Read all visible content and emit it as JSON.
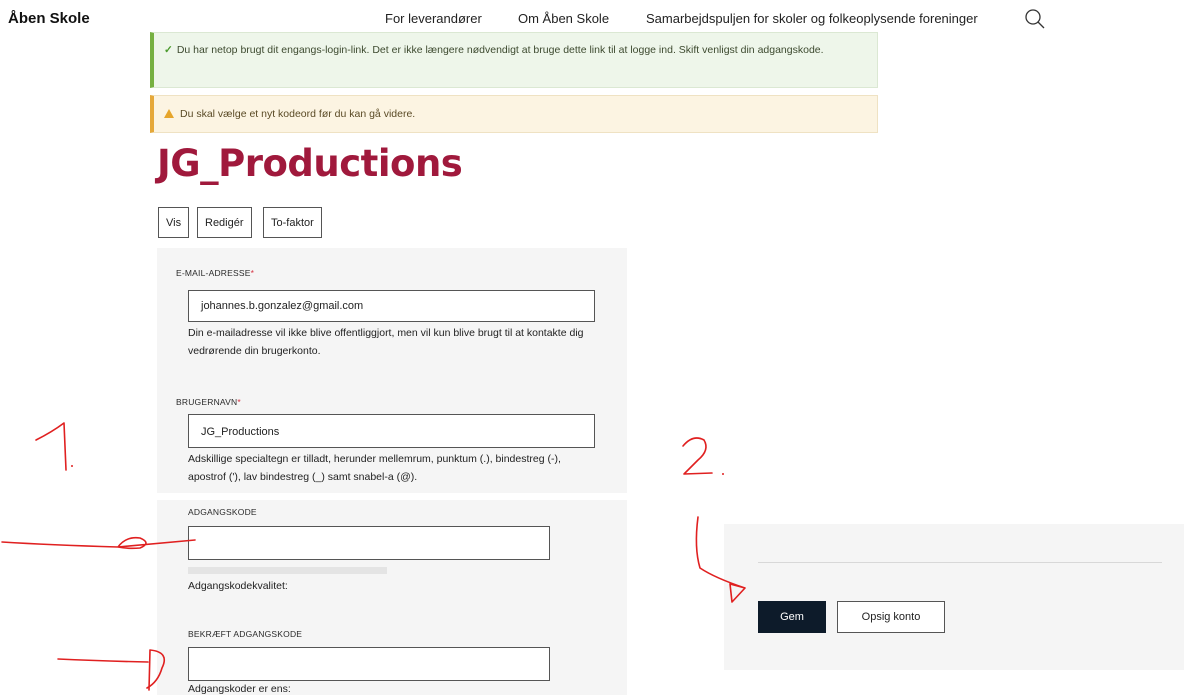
{
  "header": {
    "logo": "Åben Skole",
    "nav": [
      "For leverandører",
      "Om Åben Skole",
      "Samarbejdspuljen for skoler og folkeoplysende foreninger"
    ],
    "search_icon": "search-icon"
  },
  "messages": {
    "status": "Du har netop brugt dit engangs-login-link. Det er ikke længere nødvendigt at bruge dette link til at logge ind. Skift venligst din adgangskode.",
    "warning": "Du skal vælge et nyt kodeord før du kan gå videre."
  },
  "page": {
    "title": "JG_Productions"
  },
  "tabs": [
    "Vis",
    "Redigér",
    "To-faktor"
  ],
  "form": {
    "email": {
      "label": "E-MAIL-ADRESSE",
      "required_marker": "*",
      "value": "johannes.b.gonzalez@gmail.com",
      "help": "Din e-mailadresse vil ikke blive offentliggjort, men vil kun blive brugt til at kontakte dig vedrørende din brugerkonto."
    },
    "username": {
      "label": "BRUGERNAVN",
      "required_marker": "*",
      "value": "JG_Productions",
      "help": "Adskillige specialtegn er tilladt, herunder mellemrum, punktum (.), bindestreg (-), apostrof ('), lav bindestreg (_) samt snabel-a (@)."
    },
    "password": {
      "label": "ADGANGSKODE",
      "value": "",
      "strength_label": "Adgangskodekvalitet:",
      "strength_fraction": 0
    },
    "confirm": {
      "label": "BEKRÆFT ADGANGSKODE",
      "value": "",
      "match_label": "Adgangskoder er ens:"
    }
  },
  "actions": {
    "save": "Gem",
    "cancel_account": "Opsig konto"
  },
  "annotations": {
    "one": "1.",
    "two": "2."
  },
  "colors": {
    "title": "#a0193c",
    "save_bg": "#0d1b2a",
    "ink": "#e02020",
    "ok_border": "#76b041",
    "warn_border": "#e5a83a"
  }
}
